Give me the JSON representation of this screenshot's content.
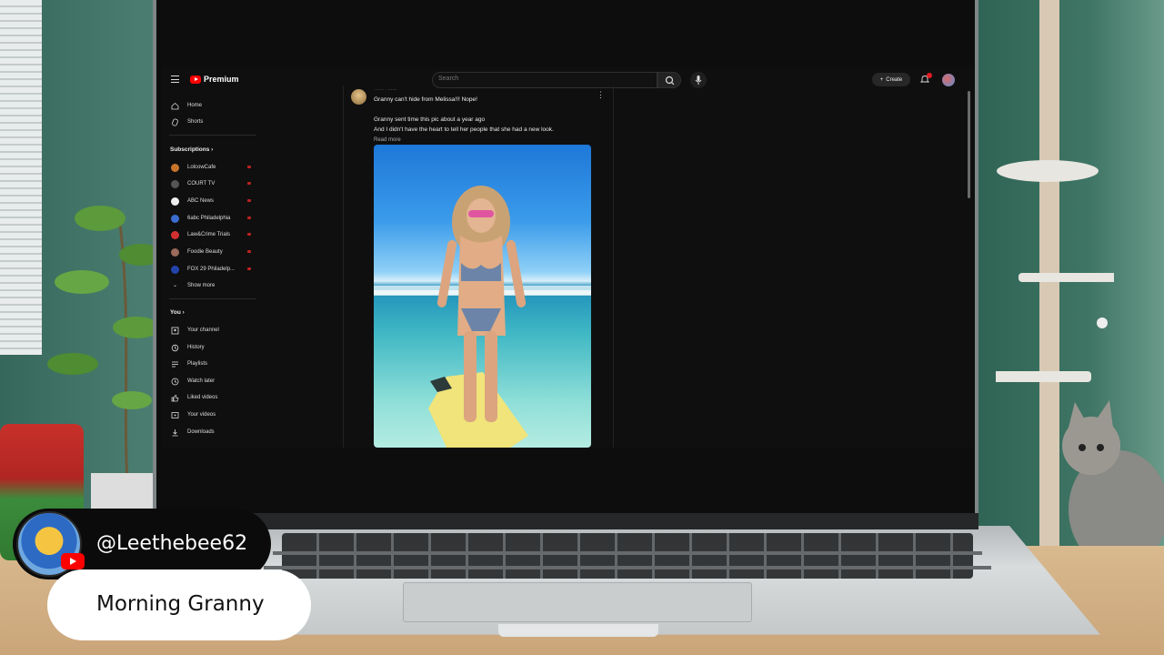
{
  "masthead": {
    "logo_text": "Premium",
    "search_placeholder": "Search",
    "create_label": "Create",
    "icons": [
      "menu-icon",
      "youtube-logo-icon",
      "search-icon",
      "mic-icon",
      "plus-icon",
      "bell-icon",
      "account-avatar"
    ]
  },
  "sidebar": {
    "main": [
      {
        "label": "Home",
        "icon": "home-icon"
      },
      {
        "label": "Shorts",
        "icon": "shorts-icon"
      }
    ],
    "subscriptions_heading": "Subscriptions",
    "subscriptions": [
      {
        "label": "LolcowCafe",
        "color": "#c8742a"
      },
      {
        "label": "COURT TV",
        "color": "#555555"
      },
      {
        "label": "ABC News",
        "color": "#eeeeee"
      },
      {
        "label": "6abc Philadelphia",
        "color": "#3b6ccf"
      },
      {
        "label": "Law&Crime Trials",
        "color": "#d23030"
      },
      {
        "label": "Foodie Beauty",
        "color": "#9a6a5a"
      },
      {
        "label": "FOX 29 Philadelp...",
        "color": "#2244aa"
      }
    ],
    "show_more_label": "Show more",
    "you_heading": "You",
    "you_items": [
      {
        "label": "Your channel",
        "icon": "channel-icon"
      },
      {
        "label": "History",
        "icon": "history-icon"
      },
      {
        "label": "Playlists",
        "icon": "playlists-icon"
      },
      {
        "label": "Watch later",
        "icon": "clock-icon"
      },
      {
        "label": "Liked videos",
        "icon": "thumbs-up-icon"
      },
      {
        "label": "Your videos",
        "icon": "video-icon"
      },
      {
        "label": "Downloads",
        "icon": "download-icon"
      }
    ]
  },
  "post": {
    "title": "Granny can't hide from Melissa!!! Nope!",
    "line1": "Granny sent time this pic about a year ago",
    "line2": "And I didn't have the heart to tell her people that she had a new look.",
    "read_more": "Read more",
    "menu_icon": "more-vert-icon"
  },
  "overlay": {
    "handle": "@Leethebee62",
    "title": "Morning Granny",
    "icons": [
      "bee-avatar",
      "youtube-badge-icon"
    ]
  },
  "colors": {
    "youtube_red": "#ff0000",
    "screen_bg": "#0f0f0f"
  }
}
